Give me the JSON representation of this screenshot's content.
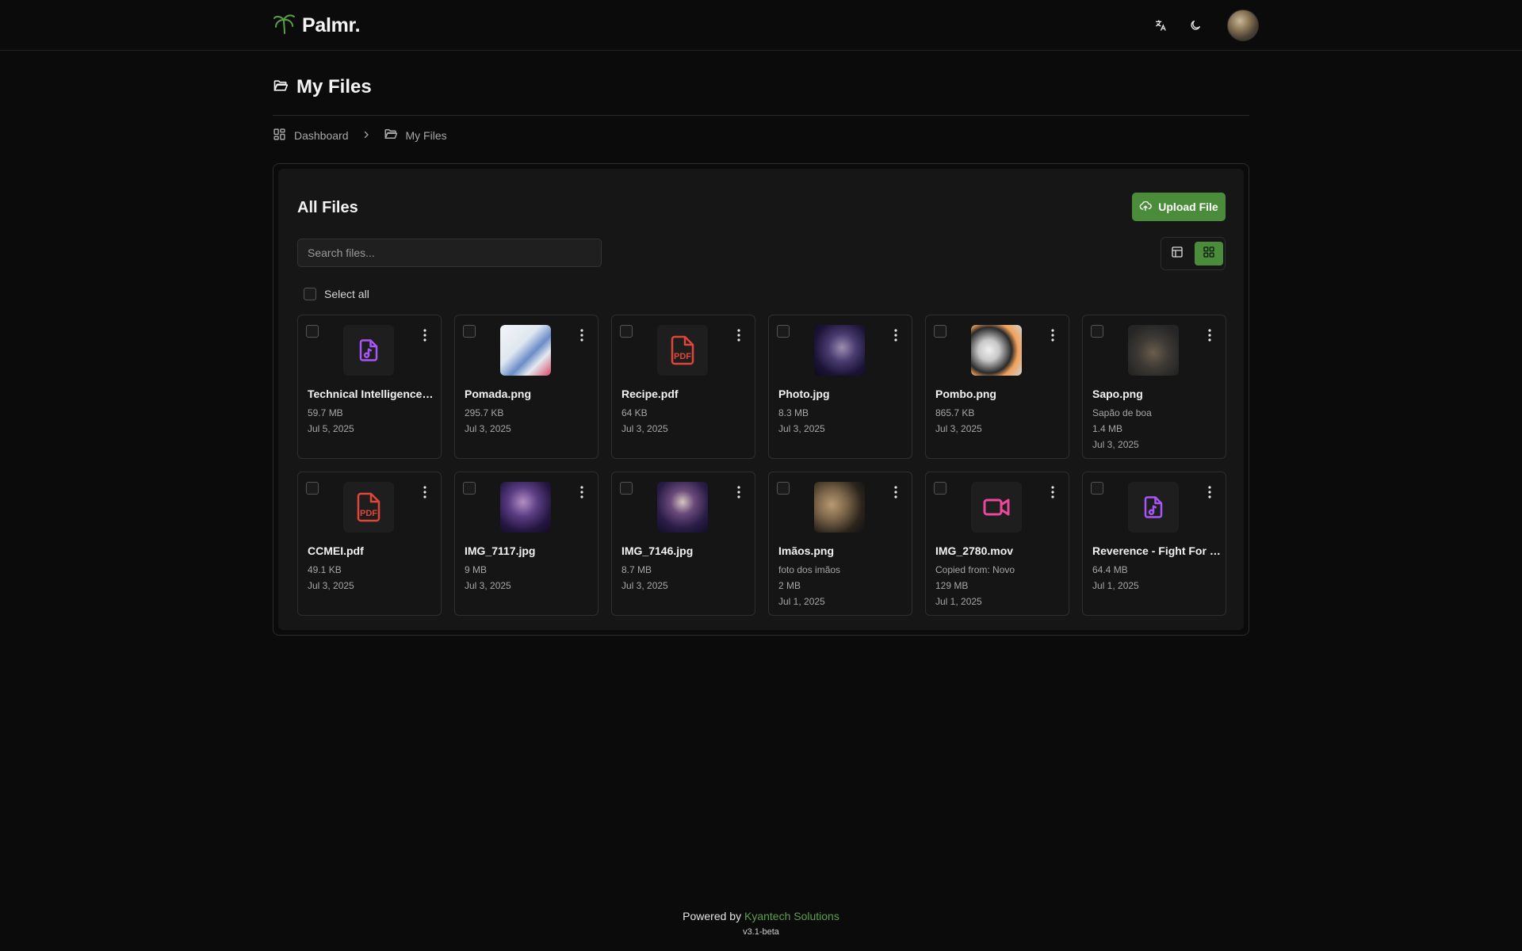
{
  "brand": {
    "name": "Palmr.",
    "logo_icon": "palm-tree-icon",
    "accent": "#4a8c3a"
  },
  "header": {
    "translate_icon": "translate-icon",
    "theme_icon": "moon-icon"
  },
  "page": {
    "title": "My Files"
  },
  "breadcrumb": {
    "items": [
      "Dashboard",
      "My Files"
    ]
  },
  "files_card": {
    "title": "All Files",
    "upload_label": "Upload File",
    "search_placeholder": "Search files...",
    "select_all_label": "Select all",
    "view_mode": "grid"
  },
  "files": [
    {
      "name": "Technical Intelligence - ...",
      "desc": "",
      "size": "59.7 MB",
      "date": "Jul 5, 2025",
      "kind": "audio"
    },
    {
      "name": "Pomada.png",
      "desc": "",
      "size": "295.7 KB",
      "date": "Jul 3, 2025",
      "kind": "image"
    },
    {
      "name": "Recipe.pdf",
      "desc": "",
      "size": "64 KB",
      "date": "Jul 3, 2025",
      "kind": "pdf"
    },
    {
      "name": "Photo.jpg",
      "desc": "",
      "size": "8.3 MB",
      "date": "Jul 3, 2025",
      "kind": "image"
    },
    {
      "name": "Pombo.png",
      "desc": "",
      "size": "865.7 KB",
      "date": "Jul 3, 2025",
      "kind": "image"
    },
    {
      "name": "Sapo.png",
      "desc": "Sapão de boa",
      "size": "1.4 MB",
      "date": "Jul 3, 2025",
      "kind": "image"
    },
    {
      "name": "CCMEI.pdf",
      "desc": "",
      "size": "49.1 KB",
      "date": "Jul 3, 2025",
      "kind": "pdf"
    },
    {
      "name": "IMG_7117.jpg",
      "desc": "",
      "size": "9 MB",
      "date": "Jul 3, 2025",
      "kind": "image"
    },
    {
      "name": "IMG_7146.jpg",
      "desc": "",
      "size": "8.7 MB",
      "date": "Jul 3, 2025",
      "kind": "image"
    },
    {
      "name": "Imãos.png",
      "desc": "foto dos imãos",
      "size": "2 MB",
      "date": "Jul 1, 2025",
      "kind": "image"
    },
    {
      "name": "IMG_2780.mov",
      "desc": "Copied from: Novo",
      "size": "129 MB",
      "date": "Jul 1, 2025",
      "kind": "video"
    },
    {
      "name": "Reverence - Fight For L...",
      "desc": "",
      "size": "64.4 MB",
      "date": "Jul 1, 2025",
      "kind": "audio"
    }
  ],
  "footer": {
    "powered_by": "Powered by",
    "company": "Kyantech Solutions",
    "version": "v3.1-beta"
  }
}
